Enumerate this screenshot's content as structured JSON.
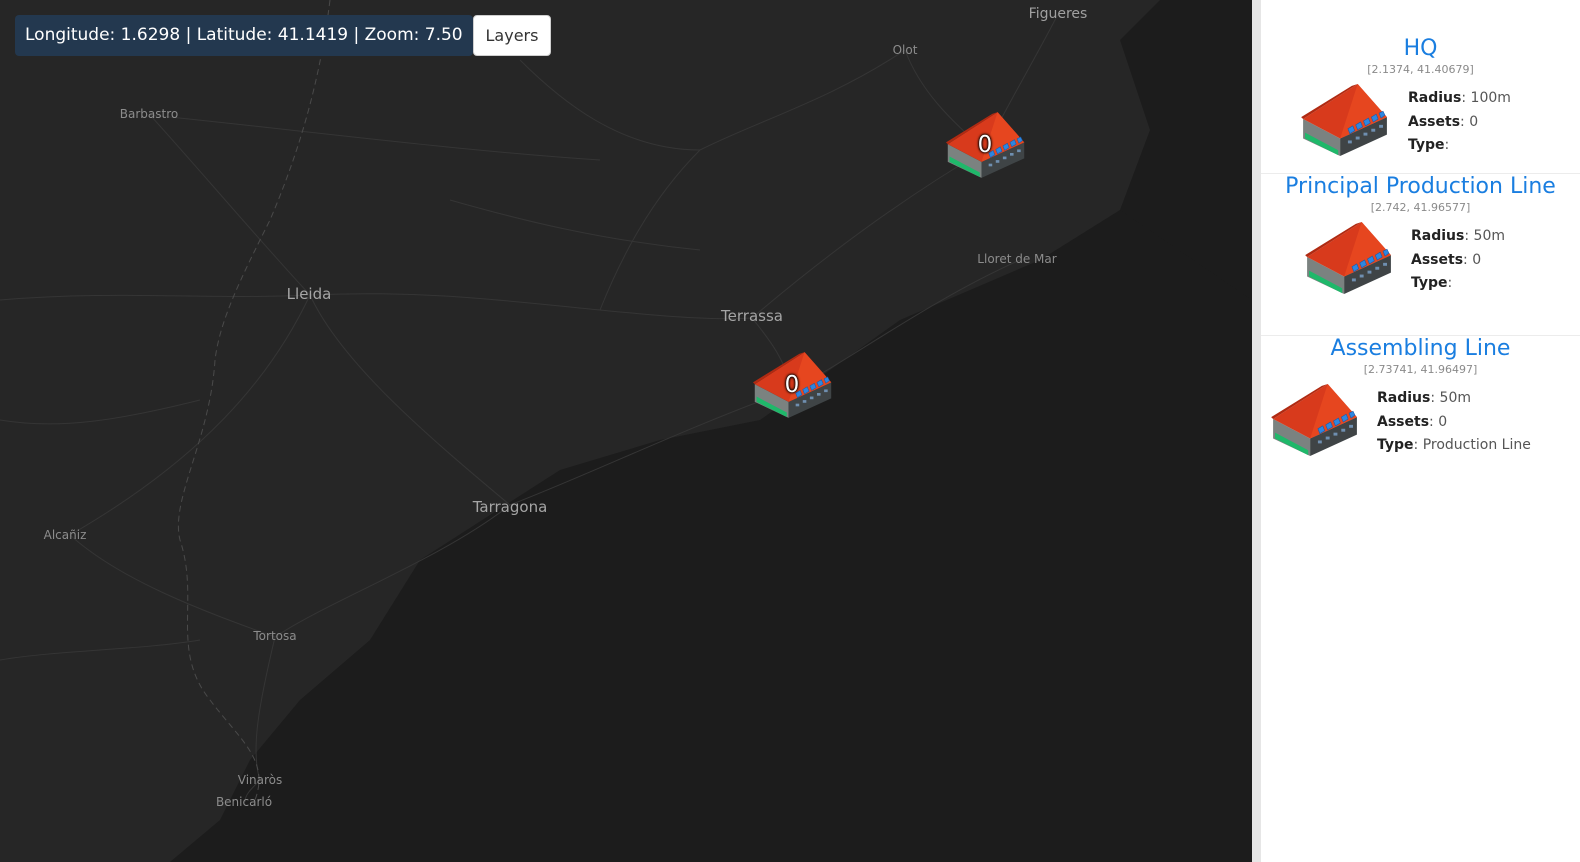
{
  "map": {
    "coords_display": "Longitude: 1.6298 | Latitude: 41.1419 | Zoom: 7.50",
    "layers_label": "Layers",
    "colors": {
      "land": "#262626",
      "sea": "#1c1c1c",
      "roads": "#3a3a3a",
      "labels": "#8c8c8c"
    },
    "cities": [
      {
        "name": "Figueres",
        "size": "medium"
      },
      {
        "name": "Olot",
        "size": "small"
      },
      {
        "name": "Barbastro",
        "size": "small"
      },
      {
        "name": "Lleida",
        "size": "large"
      },
      {
        "name": "Terrassa",
        "size": "large"
      },
      {
        "name": "Lloret de Mar",
        "size": "small"
      },
      {
        "name": "Tarragona",
        "size": "large"
      },
      {
        "name": "Alcañiz",
        "size": "small"
      },
      {
        "name": "Tortosa",
        "size": "small"
      },
      {
        "name": "Vinaròs",
        "size": "small"
      },
      {
        "name": "Benicarló",
        "size": "small"
      }
    ],
    "markers": [
      {
        "icon": "factory-icon",
        "count": "0"
      },
      {
        "icon": "factory-icon",
        "count": "0"
      }
    ]
  },
  "sites": [
    {
      "title": "HQ",
      "coords": "[2.1374, 41.40679]",
      "props": [
        {
          "label": "Radius",
          "value": "100m"
        },
        {
          "label": "Assets",
          "value": "0"
        },
        {
          "label": "Type",
          "value": ""
        }
      ]
    },
    {
      "title": "Principal Production Line",
      "coords": "[2.742, 41.96577]",
      "props": [
        {
          "label": "Radius",
          "value": "50m"
        },
        {
          "label": "Assets",
          "value": "0"
        },
        {
          "label": "Type",
          "value": ""
        }
      ]
    },
    {
      "title": "Assembling Line",
      "coords": "[2.73741, 41.96497]",
      "props": [
        {
          "label": "Radius",
          "value": "50m"
        },
        {
          "label": "Assets",
          "value": "0"
        },
        {
          "label": "Type",
          "value": "Production Line"
        }
      ]
    }
  ]
}
